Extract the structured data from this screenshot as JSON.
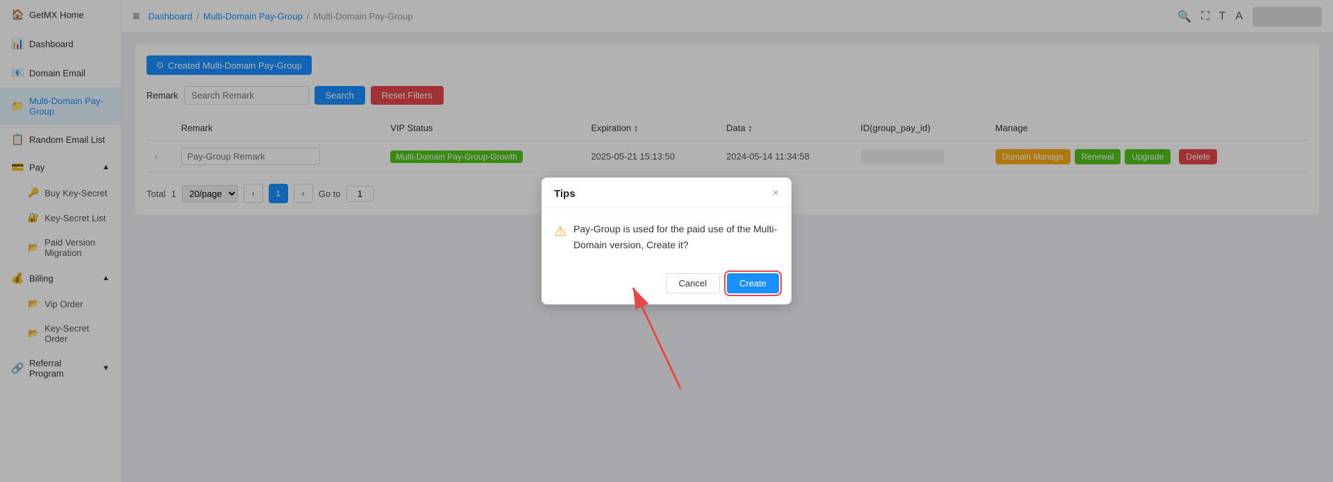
{
  "sidebar": {
    "logo_label": "GetMX Home",
    "items": [
      {
        "id": "getmx-home",
        "label": "GetMX Home",
        "icon": "🏠",
        "active": false
      },
      {
        "id": "dashboard",
        "label": "Dashboard",
        "icon": "📊",
        "active": false
      },
      {
        "id": "domain-email",
        "label": "Domain Email",
        "icon": "📧",
        "active": false
      },
      {
        "id": "multi-domain",
        "label": "Multi-Domain Pay-Group",
        "icon": "📁",
        "active": true
      },
      {
        "id": "random-email",
        "label": "Random Email List",
        "icon": "📋",
        "active": false
      }
    ],
    "pay_section": {
      "label": "Pay",
      "icon": "💳",
      "sub_items": [
        {
          "id": "buy-key",
          "label": "Buy Key-Secret",
          "icon": "🔑"
        },
        {
          "id": "key-list",
          "label": "Key-Secret List",
          "icon": "🔐"
        },
        {
          "id": "paid-migration",
          "label": "Paid Version Migration",
          "icon": "📂",
          "active": false
        }
      ]
    },
    "billing_section": {
      "label": "Billing",
      "icon": "💰",
      "sub_items": [
        {
          "id": "vip-order",
          "label": "Vip Order",
          "icon": "📂"
        },
        {
          "id": "key-secret-order",
          "label": "Key-Secret Order",
          "icon": "📂"
        }
      ]
    },
    "referral_section": {
      "label": "Referral Program",
      "icon": "🔗"
    }
  },
  "header": {
    "hamburger": "≡",
    "breadcrumbs": [
      "Dashboard",
      "Multi-Domain Pay-Group",
      "Multi-Domain Pay-Group"
    ],
    "breadcrumb_separator": "/"
  },
  "toolbar": {
    "created_label": "Created Multi-Domain Pay-Group"
  },
  "filter": {
    "remark_label": "Remark",
    "search_placeholder": "Search Remark",
    "search_button": "Search",
    "reset_button": "Reset Filters"
  },
  "table": {
    "columns": [
      "",
      "Remark",
      "VIP Status",
      "Expiration ↕",
      "Data ↕",
      "ID(group_pay_id)",
      "Manage"
    ],
    "rows": [
      {
        "remark_placeholder": "Pay-Group Remark",
        "vip_status": "Multi-Domain Pay-Group-Growth",
        "expiration": "2025-05-21 15:13:50",
        "data": "2024-05-14 11:34:58",
        "id": "",
        "manage": {
          "domain": "Domain Manage",
          "renewal": "Renewal",
          "upgrade": "Upgrade",
          "delete": "Delete"
        }
      }
    ]
  },
  "pagination": {
    "total_label": "Total",
    "total": "1",
    "per_page": "20/page",
    "prev": "‹",
    "next": "›",
    "current_page": "1",
    "goto_label": "Go to",
    "goto_value": "1"
  },
  "dialog": {
    "title": "Tips",
    "close_icon": "×",
    "icon": "⚠",
    "message": "Pay-Group is used for the paid use of the Multi-Domain version, Create it?",
    "cancel_button": "Cancel",
    "create_button": "Create"
  }
}
